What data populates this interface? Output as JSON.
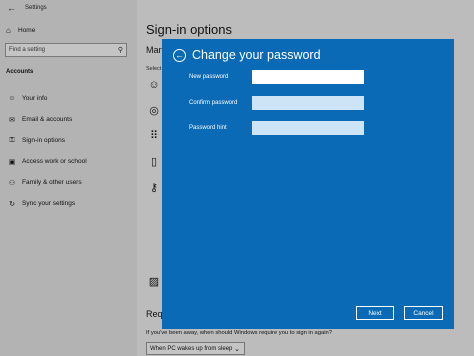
{
  "window": {
    "app_title": "Settings",
    "back_icon": "back-arrow-icon"
  },
  "sidebar": {
    "home_label": "Home",
    "search_placeholder": "Find a setting",
    "section_label": "Accounts",
    "items": [
      {
        "label": "Your info",
        "icon": "person-card-icon"
      },
      {
        "label": "Email & accounts",
        "icon": "mail-icon"
      },
      {
        "label": "Sign-in options",
        "icon": "key-icon"
      },
      {
        "label": "Access work or school",
        "icon": "briefcase-icon"
      },
      {
        "label": "Family & other users",
        "icon": "people-icon"
      },
      {
        "label": "Sync your settings",
        "icon": "sync-icon"
      }
    ]
  },
  "main": {
    "page_title": "Sign-in options",
    "manage_heading": "Mana",
    "select_text": "Select",
    "require_heading": "Requi",
    "require_text": "If you've been away, when should Windows require you to sign in again?",
    "sleep_option": "When PC wakes up from sleep"
  },
  "dialog": {
    "title": "Change your password",
    "fields": {
      "new_password_label": "New password",
      "new_password_value": "",
      "confirm_password_label": "Confirm password",
      "confirm_password_value": "",
      "password_hint_label": "Password hint",
      "password_hint_value": ""
    },
    "next_label": "Next",
    "cancel_label": "Cancel"
  },
  "colors": {
    "dialog_bg": "#0a6ab6",
    "dim_overlay": "#b9b9b9",
    "input_active": "#ffffff",
    "input_inactive": "#cce4f5"
  }
}
